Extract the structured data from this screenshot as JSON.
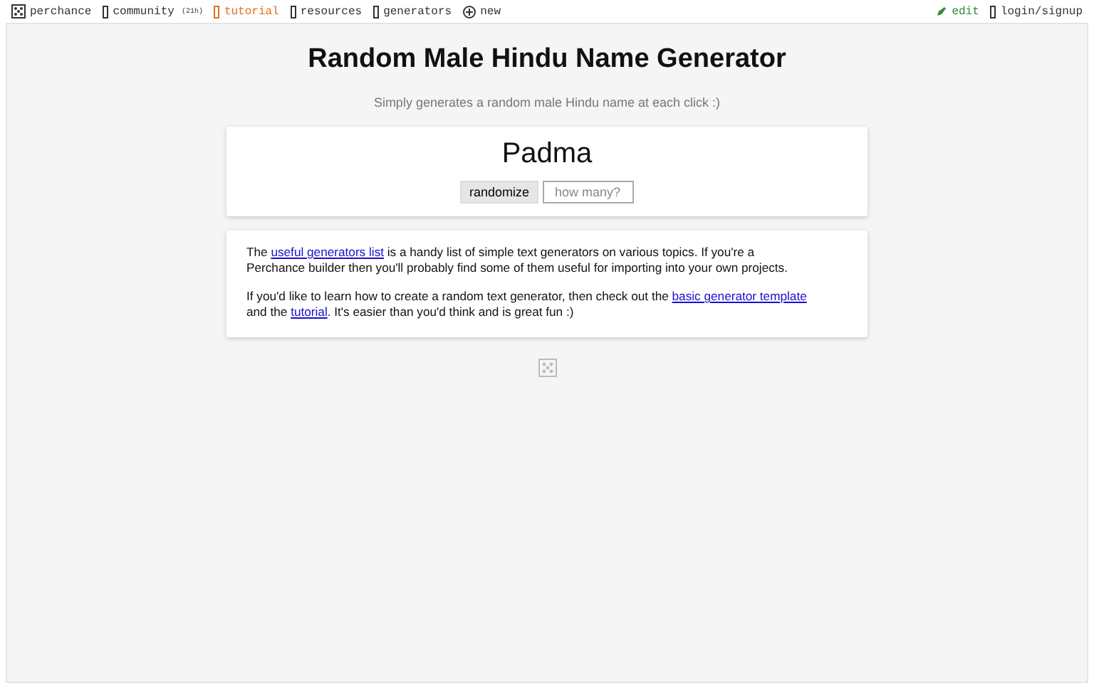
{
  "nav": {
    "left": [
      {
        "label": "perchance",
        "kind": "dice",
        "color": "#333333"
      },
      {
        "label": "community",
        "kind": "box",
        "badge": "(21h)",
        "color": "#333333"
      },
      {
        "label": "tutorial",
        "kind": "box",
        "color": "#e07020"
      },
      {
        "label": "resources",
        "kind": "box",
        "color": "#333333"
      },
      {
        "label": "generators",
        "kind": "box",
        "color": "#333333"
      },
      {
        "label": "new",
        "kind": "plus",
        "color": "#333333"
      }
    ],
    "right": [
      {
        "label": "edit",
        "kind": "pencil",
        "color": "#2e8b2e"
      },
      {
        "label": "login/signup",
        "kind": "box",
        "color": "#333333"
      }
    ]
  },
  "title": "Random Male Hindu Name Generator",
  "subtitle": "Simply generates a random male Hindu name at each click :)",
  "result": "Padma",
  "randomize_button": "randomize",
  "count_field": {
    "placeholder": "how many?"
  },
  "info": [
    [
      {
        "kind": "text",
        "text": "The "
      },
      {
        "kind": "link",
        "text": "useful generators list"
      },
      {
        "kind": "text",
        "text": " is a handy list of simple text generators on various topics. If you're a Perchance builder then you'll probably find some of them useful for importing into your own projects."
      }
    ],
    [
      {
        "kind": "text",
        "text": "If you'd like to learn how to create a random text generator, then check out the "
      },
      {
        "kind": "link",
        "text": "basic generator template"
      },
      {
        "kind": "text",
        "text": " and the "
      },
      {
        "kind": "link",
        "text": "tutorial"
      },
      {
        "kind": "text",
        "text": ". It's easier than you'd think and is great fun :)"
      }
    ]
  ]
}
